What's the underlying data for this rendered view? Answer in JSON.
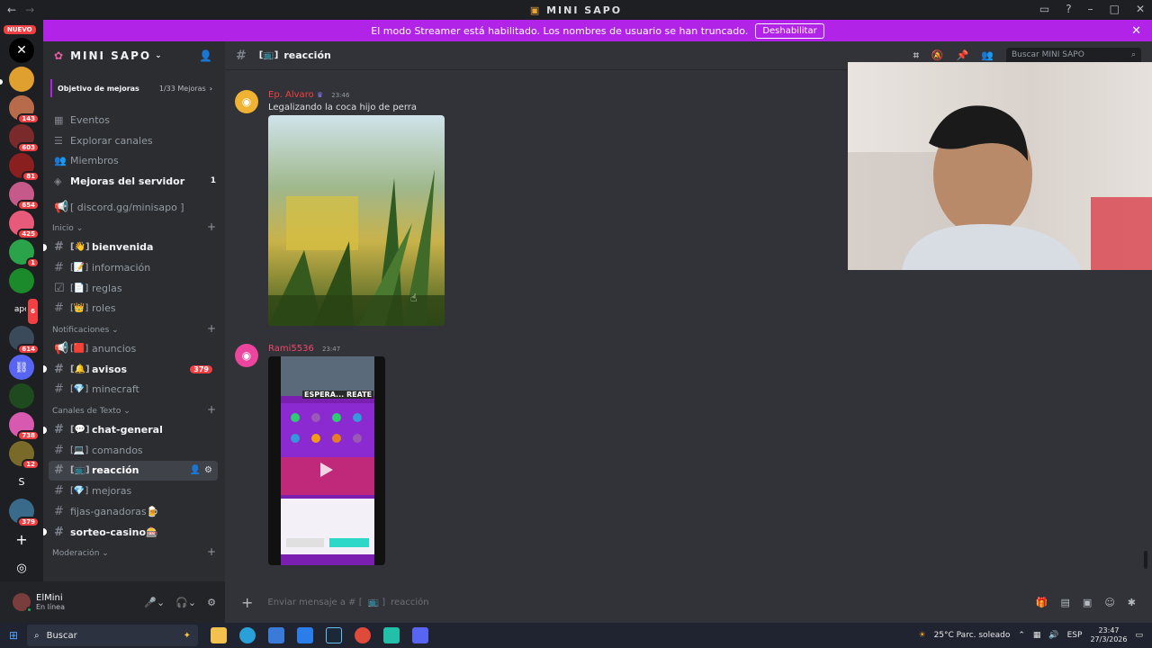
{
  "window": {
    "title": "MINI SAPO"
  },
  "banner": {
    "text": "El modo Streamer está habilitado. Los nombres de usuario se han truncado.",
    "button": "Deshabilitar"
  },
  "guilds": {
    "new_label": "NUEVO",
    "badges": [
      "143",
      "603",
      "81",
      "654",
      "425",
      "1",
      "6",
      "614",
      "738",
      "12",
      "379"
    ],
    "letters": {
      "apc": "apc",
      "s": "S"
    }
  },
  "server": {
    "name": "MINI SAPO",
    "boost_label": "Objetivo de mejoras",
    "boost_count": "1/33 Mejoras",
    "menu": [
      {
        "label": "Eventos",
        "icon": "calendar-icon"
      },
      {
        "label": "Explorar canales",
        "icon": "browse-icon"
      },
      {
        "label": "Miembros",
        "icon": "members-icon"
      },
      {
        "label": "Mejoras del servidor",
        "icon": "boost-icon",
        "count": "1"
      }
    ],
    "invite_channel": "[ discord.gg/minisapo ]",
    "categories": {
      "inicio": "Inicio",
      "notificaciones": "Notificaciones",
      "texto": "Canales de Texto",
      "moderacion": "Moderación"
    },
    "channels": {
      "bienvenida": "bienvenida",
      "informacion": "información",
      "reglas": "reglas",
      "roles": "roles",
      "anuncios": "anuncios",
      "avisos": "avisos",
      "avisos_mentions": "379",
      "minecraft": "minecraft",
      "chat_general": "chat-general",
      "comandos": "comandos",
      "reaccion": "reacción",
      "mejoras": "mejoras",
      "fijas": "fijas-ganadoras",
      "sorteo": "sorteo-casino"
    }
  },
  "user": {
    "name": "ElMini",
    "status": "En línea"
  },
  "channel_header": {
    "name": "reacción",
    "search_placeholder": "Buscar MINI SAPO"
  },
  "messages": [
    {
      "author": "Ep. Alvaro",
      "time": "23:46",
      "text": "Legalizando la coca hijo de perra",
      "author_color": "#f23f43"
    },
    {
      "author": "Rami5536",
      "time": "23:47",
      "author_color": "#f0476b",
      "overlay_text": "ESPERA... REATE"
    }
  ],
  "composer": {
    "placeholder": "Enviar mensaje a # [",
    "channel": "reacción"
  },
  "taskbar": {
    "search": "Buscar",
    "weather": "25°C  Parc. soleado",
    "lang": "ESP",
    "time": "23:47",
    "date": "27/3/2026",
    "weather_badge": "1"
  },
  "colors": {
    "accent": "#b223e8",
    "discord_blurple": "#5865f2",
    "mention_red": "#f23f43"
  }
}
